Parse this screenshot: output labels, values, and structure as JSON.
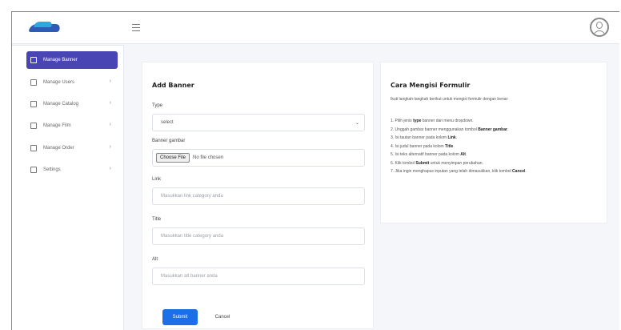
{
  "sidebar": {
    "items": [
      {
        "label": "Manage Banner",
        "active": true,
        "icon": "banner-icon"
      },
      {
        "label": "Manage Users",
        "chevron": "›",
        "icon": "users-icon"
      },
      {
        "label": "Manage Catalog",
        "chevron": "›",
        "icon": "catalog-icon"
      },
      {
        "label": "Manage Film",
        "chevron": "›",
        "icon": "film-icon"
      },
      {
        "label": "Manage Order",
        "chevron": "›",
        "icon": "order-icon"
      },
      {
        "label": "Settings",
        "chevron": "›",
        "icon": "settings-icon"
      }
    ]
  },
  "form": {
    "title": "Add Banner",
    "type_label": "Type",
    "type_value": "select",
    "image_label": "Banner gambar",
    "choose_file_label": "Choose File",
    "no_file_text": "No file chosen",
    "link_label": "Link",
    "link_placeholder": "Masukkan link category anda",
    "title_label": "Title",
    "title_placeholder": "Masukkan title category anda",
    "alt_label": "Alt",
    "alt_placeholder": "Masukkan alt banner anda",
    "submit_label": "Submit",
    "cancel_label": "Cancel"
  },
  "guide": {
    "title": "Cara Mengisi Formulir",
    "intro": "Ikuti langkah-langkah berikut untuk mengisi formulir dengan benar:",
    "steps": [
      {
        "pre": "1. Pilih jenis ",
        "bold": "type",
        "post": " banner dari menu dropdown."
      },
      {
        "pre": "2. Unggah gambar banner menggunakan tombol ",
        "bold": "Banner gambar",
        "post": "."
      },
      {
        "pre": "3. Isi tautan banner pada kolom ",
        "bold": "Link",
        "post": "."
      },
      {
        "pre": "4. Isi judul banner pada kolom ",
        "bold": "Title",
        "post": "."
      },
      {
        "pre": "5. Isi teks alternatif banner pada kolom ",
        "bold": "Alt",
        "post": "."
      },
      {
        "pre": "6. Klik tombol ",
        "bold": "Submit",
        "post": " untuk menyimpan perubahan."
      },
      {
        "pre": "7. Jika ingin menghapus inputan yang telah dimasukkan, klik tombol ",
        "bold": "Cancel",
        "post": "."
      }
    ]
  },
  "colors": {
    "accent": "#4a45b5",
    "primary_button": "#1d6fe8"
  }
}
